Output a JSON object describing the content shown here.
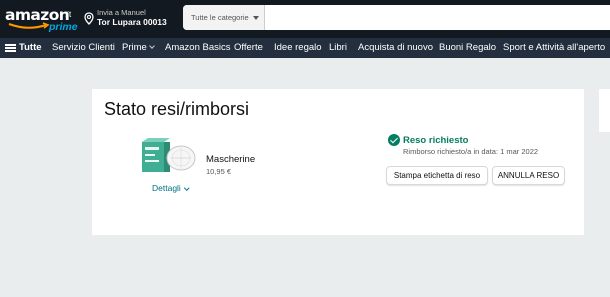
{
  "header": {
    "logo_word": "amazon",
    "logo_tld": ".it",
    "logo_prime": "prime",
    "deliver_line1": "Invia a Manuel",
    "deliver_line2": "Tor Lupara 00013",
    "search_category": "Tutte le categorie",
    "search_value": ""
  },
  "subnav": {
    "items": [
      "Tutte",
      "Servizio Clienti",
      "Prime",
      "Amazon Basics",
      "Offerte",
      "Idee regalo",
      "Libri",
      "Acquista di nuovo",
      "Buoni Regalo",
      "Sport e Attività all'aperto"
    ]
  },
  "main": {
    "title": "Stato resi/rimborsi",
    "product": {
      "name": "Mascherine",
      "price": "10,95 €",
      "details_link": "Dettagli"
    },
    "status": {
      "title": "Reso richiesto",
      "subtitle": "Rimborso richiesto/a in data: 1 mar 2022"
    },
    "buttons": {
      "print_label": "Stampa etichetta di reso",
      "cancel_label": "ANNULLA RESO"
    }
  },
  "colors": {
    "nav_dark": "#131921",
    "nav_sub": "#232f3e",
    "accent_teal": "#007185",
    "success_green": "#067d62",
    "prime_blue": "#00a8e1",
    "smile_orange": "#ff9900"
  },
  "icons": [
    "location-pin-icon",
    "caret-down-icon",
    "hamburger-menu-icon",
    "chevron-down-icon",
    "check-circle-icon"
  ]
}
